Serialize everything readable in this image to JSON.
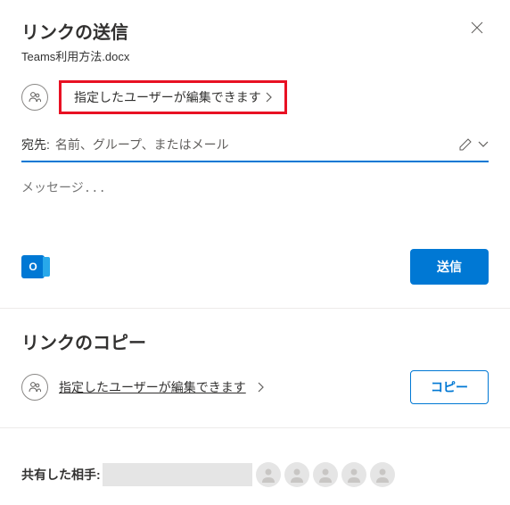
{
  "header": {
    "title": "リンクの送信",
    "subtitle": "Teams利用方法.docx"
  },
  "linkSettings": {
    "description": "指定したユーザーが編集できます"
  },
  "recipients": {
    "label": "宛先:",
    "placeholder": "名前、グループ、またはメール"
  },
  "message": {
    "placeholder": "メッセージ..."
  },
  "send": {
    "label": "送信"
  },
  "copySection": {
    "title": "リンクのコピー",
    "description": "指定したユーザーが編集できます",
    "button": "コピー"
  },
  "sharedWith": {
    "label": "共有した相手:"
  }
}
